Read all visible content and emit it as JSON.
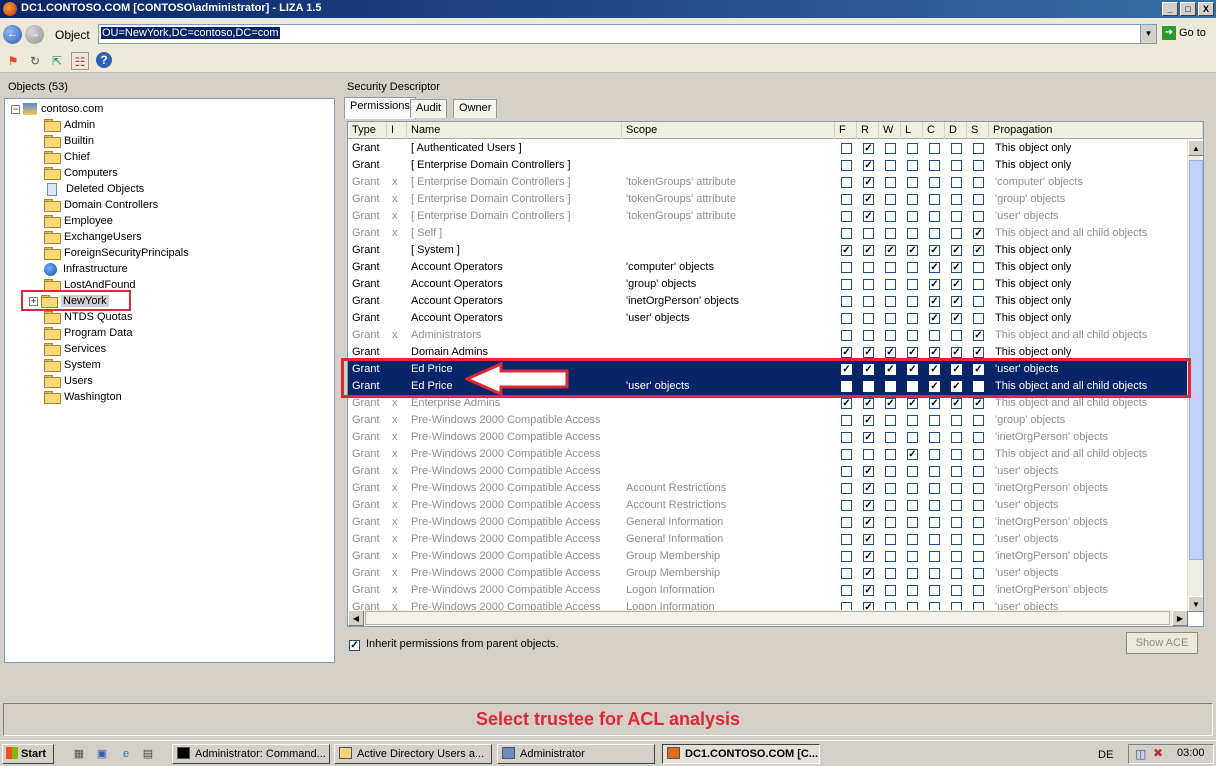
{
  "window": {
    "title": "DC1.CONTOSO.COM [CONTOSO\\administrator] - LIZA 1.5",
    "min": "_",
    "max": "□",
    "close": "X"
  },
  "address": {
    "label": "Object",
    "value": "OU=NewYork,DC=contoso,DC=com",
    "go_label": "Go to"
  },
  "toolbar": {
    "icons": [
      "windows-flag-icon",
      "refresh-icon",
      "export-icon",
      "network-icon",
      "help-icon"
    ]
  },
  "left": {
    "header": "Objects (53)",
    "root": "contoso.com",
    "items": [
      {
        "label": "Admin",
        "icon": "folder-icon"
      },
      {
        "label": "Builtin",
        "icon": "folder-icon"
      },
      {
        "label": "Chief",
        "icon": "folder-icon"
      },
      {
        "label": "Computers",
        "icon": "folder-icon"
      },
      {
        "label": "Deleted Objects",
        "icon": "recycle-bin-icon"
      },
      {
        "label": "Domain Controllers",
        "icon": "folder-icon"
      },
      {
        "label": "Employee",
        "icon": "folder-icon"
      },
      {
        "label": "ExchangeUsers",
        "icon": "folder-icon"
      },
      {
        "label": "ForeignSecurityPrincipals",
        "icon": "folder-icon"
      },
      {
        "label": "Infrastructure",
        "icon": "globe-icon"
      },
      {
        "label": "LostAndFound",
        "icon": "folder-icon"
      },
      {
        "label": "NewYork",
        "icon": "folder-open-icon",
        "selected": true
      },
      {
        "label": "NTDS Quotas",
        "icon": "folder-icon"
      },
      {
        "label": "Program Data",
        "icon": "folder-icon"
      },
      {
        "label": "Services",
        "icon": "folder-icon"
      },
      {
        "label": "System",
        "icon": "folder-icon"
      },
      {
        "label": "Users",
        "icon": "folder-icon"
      },
      {
        "label": "Washington",
        "icon": "folder-icon"
      }
    ]
  },
  "right": {
    "header": "Security Descriptor",
    "tabs": [
      "Permissions",
      "Audit",
      "Owner"
    ],
    "columns": [
      "Type",
      "I",
      "Name",
      "Scope",
      "F",
      "R",
      "W",
      "L",
      "C",
      "D",
      "S",
      "Propagation"
    ],
    "rows": [
      {
        "type": "Grant",
        "i": "",
        "name": "[ Authenticated Users ]",
        "scope": "",
        "perms": [
          0,
          1,
          0,
          0,
          0,
          0,
          0
        ],
        "prop": "This object only",
        "dim": false,
        "sel": false
      },
      {
        "type": "Grant",
        "i": "",
        "name": "[ Enterprise Domain Controllers ]",
        "scope": "",
        "perms": [
          0,
          1,
          0,
          0,
          0,
          0,
          0
        ],
        "prop": "This object only",
        "dim": false,
        "sel": false
      },
      {
        "type": "Grant",
        "i": "x",
        "name": "[ Enterprise Domain Controllers ]",
        "scope": "'tokenGroups' attribute",
        "perms": [
          0,
          1,
          0,
          0,
          0,
          0,
          0
        ],
        "prop": "'computer' objects",
        "dim": true,
        "sel": false
      },
      {
        "type": "Grant",
        "i": "x",
        "name": "[ Enterprise Domain Controllers ]",
        "scope": "'tokenGroups' attribute",
        "perms": [
          0,
          1,
          0,
          0,
          0,
          0,
          0
        ],
        "prop": "'group' objects",
        "dim": true,
        "sel": false
      },
      {
        "type": "Grant",
        "i": "x",
        "name": "[ Enterprise Domain Controllers ]",
        "scope": "'tokenGroups' attribute",
        "perms": [
          0,
          1,
          0,
          0,
          0,
          0,
          0
        ],
        "prop": "'user' objects",
        "dim": true,
        "sel": false
      },
      {
        "type": "Grant",
        "i": "x",
        "name": "[ Self ]",
        "scope": "",
        "perms": [
          0,
          0,
          0,
          0,
          0,
          0,
          1
        ],
        "prop": "This object and all child objects",
        "dim": true,
        "sel": false
      },
      {
        "type": "Grant",
        "i": "",
        "name": "[ System ]",
        "scope": "",
        "perms": [
          1,
          1,
          1,
          1,
          1,
          1,
          1
        ],
        "prop": "This object only",
        "dim": false,
        "sel": false
      },
      {
        "type": "Grant",
        "i": "",
        "name": "Account Operators",
        "scope": "'computer' objects",
        "perms": [
          0,
          0,
          0,
          0,
          1,
          1,
          0
        ],
        "prop": "This object only",
        "dim": false,
        "sel": false
      },
      {
        "type": "Grant",
        "i": "",
        "name": "Account Operators",
        "scope": "'group' objects",
        "perms": [
          0,
          0,
          0,
          0,
          1,
          1,
          0
        ],
        "prop": "This object only",
        "dim": false,
        "sel": false
      },
      {
        "type": "Grant",
        "i": "",
        "name": "Account Operators",
        "scope": "'inetOrgPerson' objects",
        "perms": [
          0,
          0,
          0,
          0,
          1,
          1,
          0
        ],
        "prop": "This object only",
        "dim": false,
        "sel": false
      },
      {
        "type": "Grant",
        "i": "",
        "name": "Account Operators",
        "scope": "'user' objects",
        "perms": [
          0,
          0,
          0,
          0,
          1,
          1,
          0
        ],
        "prop": "This object only",
        "dim": false,
        "sel": false
      },
      {
        "type": "Grant",
        "i": "x",
        "name": "Administrators",
        "scope": "",
        "perms": [
          0,
          0,
          0,
          0,
          0,
          0,
          1
        ],
        "prop": "This object and all child objects",
        "dim": true,
        "sel": false
      },
      {
        "type": "Grant",
        "i": "",
        "name": "Domain Admins",
        "scope": "",
        "perms": [
          1,
          1,
          1,
          1,
          1,
          1,
          1
        ],
        "prop": "This object only",
        "dim": false,
        "sel": false
      },
      {
        "type": "Grant",
        "i": "",
        "name": "Ed Price",
        "scope": "",
        "perms": [
          1,
          1,
          1,
          1,
          1,
          1,
          1
        ],
        "prop": "'user' objects",
        "dim": false,
        "sel": true
      },
      {
        "type": "Grant",
        "i": "",
        "name": "Ed Price",
        "scope": "'user' objects",
        "perms": [
          0,
          0,
          0,
          0,
          1,
          1,
          0
        ],
        "prop": "This object and all child objects",
        "dim": false,
        "sel": true
      },
      {
        "type": "Grant",
        "i": "x",
        "name": "Enterprise Admins",
        "scope": "",
        "perms": [
          1,
          1,
          1,
          1,
          1,
          1,
          1
        ],
        "prop": "This object and all child objects",
        "dim": true,
        "sel": false
      },
      {
        "type": "Grant",
        "i": "x",
        "name": "Pre-Windows 2000 Compatible Access",
        "scope": "",
        "perms": [
          0,
          1,
          0,
          0,
          0,
          0,
          0
        ],
        "prop": "'group' objects",
        "dim": true,
        "sel": false
      },
      {
        "type": "Grant",
        "i": "x",
        "name": "Pre-Windows 2000 Compatible Access",
        "scope": "",
        "perms": [
          0,
          1,
          0,
          0,
          0,
          0,
          0
        ],
        "prop": "'inetOrgPerson' objects",
        "dim": true,
        "sel": false
      },
      {
        "type": "Grant",
        "i": "x",
        "name": "Pre-Windows 2000 Compatible Access",
        "scope": "",
        "perms": [
          0,
          0,
          0,
          1,
          0,
          0,
          0
        ],
        "prop": "This object and all child objects",
        "dim": true,
        "sel": false
      },
      {
        "type": "Grant",
        "i": "x",
        "name": "Pre-Windows 2000 Compatible Access",
        "scope": "",
        "perms": [
          0,
          1,
          0,
          0,
          0,
          0,
          0
        ],
        "prop": "'user' objects",
        "dim": true,
        "sel": false
      },
      {
        "type": "Grant",
        "i": "x",
        "name": "Pre-Windows 2000 Compatible Access",
        "scope": "Account Restrictions",
        "perms": [
          0,
          1,
          0,
          0,
          0,
          0,
          0
        ],
        "prop": "'inetOrgPerson' objects",
        "dim": true,
        "sel": false
      },
      {
        "type": "Grant",
        "i": "x",
        "name": "Pre-Windows 2000 Compatible Access",
        "scope": "Account Restrictions",
        "perms": [
          0,
          1,
          0,
          0,
          0,
          0,
          0
        ],
        "prop": "'user' objects",
        "dim": true,
        "sel": false
      },
      {
        "type": "Grant",
        "i": "x",
        "name": "Pre-Windows 2000 Compatible Access",
        "scope": "General Information",
        "perms": [
          0,
          1,
          0,
          0,
          0,
          0,
          0
        ],
        "prop": "'inetOrgPerson' objects",
        "dim": true,
        "sel": false
      },
      {
        "type": "Grant",
        "i": "x",
        "name": "Pre-Windows 2000 Compatible Access",
        "scope": "General Information",
        "perms": [
          0,
          1,
          0,
          0,
          0,
          0,
          0
        ],
        "prop": "'user' objects",
        "dim": true,
        "sel": false
      },
      {
        "type": "Grant",
        "i": "x",
        "name": "Pre-Windows 2000 Compatible Access",
        "scope": "Group Membership",
        "perms": [
          0,
          1,
          0,
          0,
          0,
          0,
          0
        ],
        "prop": "'inetOrgPerson' objects",
        "dim": true,
        "sel": false
      },
      {
        "type": "Grant",
        "i": "x",
        "name": "Pre-Windows 2000 Compatible Access",
        "scope": "Group Membership",
        "perms": [
          0,
          1,
          0,
          0,
          0,
          0,
          0
        ],
        "prop": "'user' objects",
        "dim": true,
        "sel": false
      },
      {
        "type": "Grant",
        "i": "x",
        "name": "Pre-Windows 2000 Compatible Access",
        "scope": "Logon Information",
        "perms": [
          0,
          1,
          0,
          0,
          0,
          0,
          0
        ],
        "prop": "'inetOrgPerson' objects",
        "dim": true,
        "sel": false
      },
      {
        "type": "Grant",
        "i": "x",
        "name": "Pre-Windows 2000 Compatible Access",
        "scope": "Logon Information",
        "perms": [
          0,
          1,
          0,
          0,
          0,
          0,
          0
        ],
        "prop": "'user' objects",
        "dim": true,
        "sel": false
      }
    ],
    "inherit_label": "Inherit permissions from parent objects.",
    "inherit_checked": true,
    "show_ace": "Show ACE"
  },
  "caption": "Select trustee for ACL analysis",
  "taskbar": {
    "start": "Start",
    "tasks": [
      {
        "label": "Administrator: Command...",
        "icon": "cmd-icon",
        "active": false
      },
      {
        "label": "Active Directory Users a...",
        "icon": "ad-icon",
        "active": false
      },
      {
        "label": "Administrator",
        "icon": "remote-icon",
        "active": false
      },
      {
        "label": "DC1.CONTOSO.COM [C...",
        "icon": "liza-icon",
        "active": true
      }
    ],
    "lang": "DE",
    "clock": "03:00"
  },
  "colors": {
    "selection": "#0a246a",
    "annotation": "#e32636"
  }
}
